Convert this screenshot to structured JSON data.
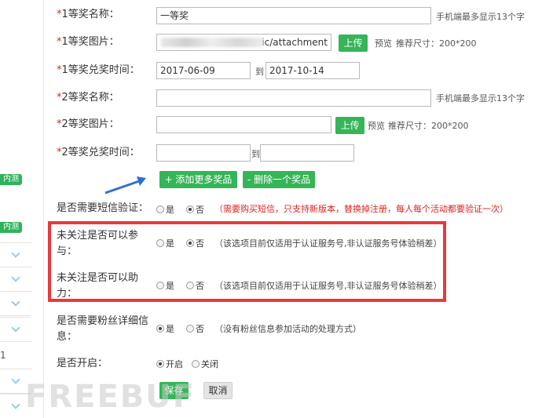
{
  "sidebar": {
    "badges": [
      "内测",
      "内测"
    ],
    "number": "1"
  },
  "form": {
    "prize1_name": {
      "label": "*1等奖名称：",
      "value": "一等奖",
      "hint": "手机端最多显示13个字"
    },
    "prize1_image": {
      "label": "*1等奖图片：",
      "value": "ic/attachment",
      "upload": "上传",
      "preview": "预览",
      "size_hint": "推荐尺寸：200*200"
    },
    "prize1_time": {
      "label": "*1等奖兑奖时间：",
      "start": "2017-06-09",
      "to": "到",
      "end": "2017-10-14"
    },
    "prize2_name": {
      "label": "*2等奖名称：",
      "value": "",
      "hint": "手机端最多显示13个字"
    },
    "prize2_image": {
      "label": "*2等奖图片：",
      "value": "",
      "upload": "上传",
      "preview": "预览",
      "size_hint": "推荐尺寸：200*200"
    },
    "prize2_time": {
      "label": "*2等奖兑奖时间：",
      "start": "",
      "to": "到",
      "end": ""
    },
    "add_prize": "+ 添加更多奖品",
    "remove_prize": "- 删除一个奖品",
    "sms": {
      "label": "是否需要短信验证：",
      "yes": "是",
      "no": "否",
      "selected": "否",
      "note": "（需要购买短信，只支持新版本，替换掉注册，每人每个活动都要验证一次）"
    },
    "follow_join": {
      "label_line1": "未关注是否可以参",
      "label_line2": "与：",
      "yes": "是",
      "no": "否",
      "selected": "否",
      "note": "（该选项目前仅适用于认证服务号,非认证服务号体验稍差）"
    },
    "follow_help": {
      "label_line1": "未关注是否可以助",
      "label_line2": "力：",
      "yes": "是",
      "no": "否",
      "selected": "",
      "note": "（该选项目前仅适用于认证服务号,非认证服务号体验稍差）"
    },
    "fans_info": {
      "label_line1": "是否需要粉丝详细信",
      "label_line2": "息：",
      "yes": "是",
      "no": "否",
      "selected": "是",
      "note": "（没有粉丝信息参加活动的处理方式）"
    },
    "enabled": {
      "label": "是否开启：",
      "on": "开启",
      "off": "关闭",
      "selected": "开启"
    },
    "save": "保存",
    "cancel": "取消"
  },
  "watermark": "FREEBUF",
  "colors": {
    "green": "#35b558",
    "required": "#e02020",
    "highlight": "#e8393a",
    "arrow": "#2f6fd1"
  }
}
